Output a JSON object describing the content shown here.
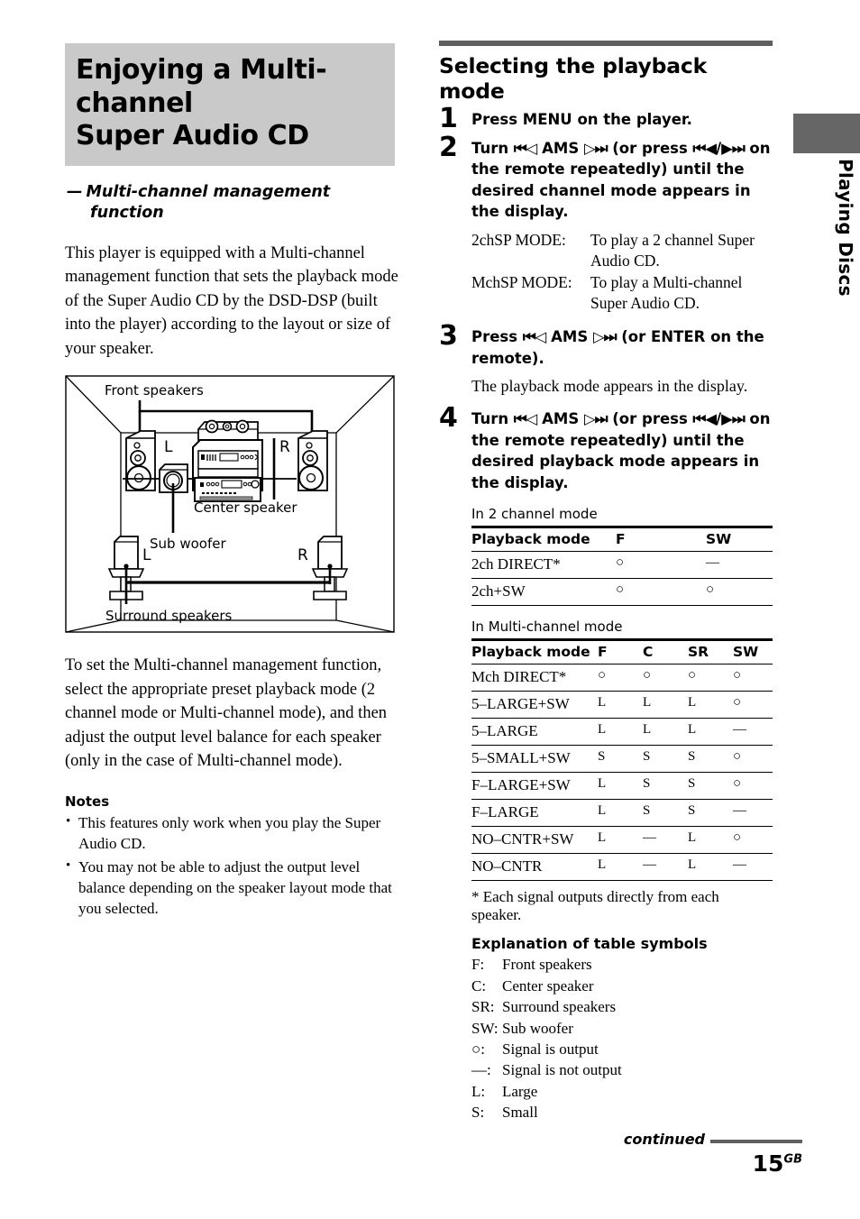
{
  "chapter": {
    "title_line1": "Enjoying a Multi-channel",
    "title_line2": "Super Audio CD",
    "subtitle_dash": "—",
    "subtitle_line1": "Multi-channel management",
    "subtitle_line2": "function"
  },
  "left": {
    "intro_paragraph": "This player is equipped with a Multi-channel management function that sets the playback mode of the Super Audio CD by the DSD-DSP (built into the player) according to the layout or size of your speaker.",
    "diagram": {
      "label_front": "Front speakers",
      "label_center": "Center speaker",
      "label_sub": "Sub woofer",
      "label_surround": "Surround speakers",
      "label_front_left": "L",
      "label_front_right": "R",
      "label_surround_left": "L",
      "label_surround_right": "R"
    },
    "second_paragraph": "To set the Multi-channel management function, select the appropriate preset playback mode (2 channel mode or Multi-channel mode), and then adjust the output level balance for each speaker (only in the case of Multi-channel mode).",
    "notes_heading": "Notes",
    "notes": [
      "This features only work when you play the Super Audio CD.",
      "You may not be able to adjust the output level balance depending on the speaker layout mode that you selected."
    ]
  },
  "right": {
    "section_heading": "Selecting the playback mode",
    "steps": [
      {
        "num": "1",
        "text_parts": [
          "Press MENU on the player."
        ]
      },
      {
        "num": "2",
        "prefix": "Turn",
        "sym_left": "⏮◁",
        "ams": "AMS",
        "sym_right": "▷⏭",
        "mid": "(or press",
        "sym_rew": "⏮◀",
        "slash": "/",
        "sym_ff": "▶⏭",
        "suffix": "on the remote repeatedly) until the desired channel mode appears in the display."
      },
      {
        "num": "3",
        "prefix": "Press",
        "sym_left": "⏮◁",
        "ams": "AMS",
        "sym_right": "▷⏭",
        "suffix": "(or ENTER on the remote).",
        "sub": "The playback mode appears in the display."
      },
      {
        "num": "4",
        "prefix": "Turn",
        "sym_left": "⏮◁",
        "ams": "AMS",
        "sym_right": "▷⏭",
        "mid": "(or press",
        "sym_rew": "⏮◀",
        "slash": "/",
        "sym_ff": "▶⏭",
        "suffix": "on the remote repeatedly) until the desired playback mode appears in the display."
      }
    ],
    "modes": [
      {
        "key": "2chSP MODE:",
        "val_line1": "To play a 2 channel Super",
        "val_line2": "Audio CD."
      },
      {
        "key": "MchSP MODE:",
        "val_line1": "To play a Multi-channel",
        "val_line2": "Super Audio CD."
      }
    ],
    "table_2ch": {
      "caption": "In 2 channel mode",
      "headers": [
        "Playback mode",
        "F",
        "SW"
      ],
      "rows": [
        [
          "2ch DIRECT*",
          "○",
          "—"
        ],
        [
          "2ch+SW",
          "○",
          "○"
        ]
      ]
    },
    "table_mch": {
      "caption": "In Multi-channel mode",
      "headers": [
        "Playback mode",
        "F",
        "C",
        "SR",
        "SW"
      ],
      "rows": [
        [
          "Mch DIRECT*",
          "○",
          "○",
          "○",
          "○"
        ],
        [
          "5–LARGE+SW",
          "L",
          "L",
          "L",
          "○"
        ],
        [
          "5–LARGE",
          "L",
          "L",
          "L",
          "—"
        ],
        [
          "5–SMALL+SW",
          "S",
          "S",
          "S",
          "○"
        ],
        [
          "F–LARGE+SW",
          "L",
          "S",
          "S",
          "○"
        ],
        [
          "F–LARGE",
          "L",
          "S",
          "S",
          "—"
        ],
        [
          "NO–CNTR+SW",
          "L",
          "—",
          "L",
          "○"
        ],
        [
          "NO–CNTR",
          "L",
          "—",
          "L",
          "—"
        ]
      ]
    },
    "footnote": "* Each signal outputs directly from each speaker.",
    "explanation_heading": "Explanation of table symbols",
    "explanation": [
      {
        "key": "F:",
        "val": "Front speakers"
      },
      {
        "key": "C:",
        "val": "Center speaker"
      },
      {
        "key": "SR:",
        "val": "Surround speakers"
      },
      {
        "key": "SW:",
        "val": "Sub woofer"
      },
      {
        "key": "○:",
        "val": "Signal is output"
      },
      {
        "key": "—:",
        "val": "Signal is not output"
      },
      {
        "key": "L:",
        "val": "Large"
      },
      {
        "key": "S:",
        "val": "Small"
      }
    ]
  },
  "side_tab": {
    "label": "Playing Discs"
  },
  "footer": {
    "continued": "continued",
    "page_number": "15",
    "page_suffix": "GB"
  },
  "colors": {
    "title_background": "#c9c9c9",
    "rule": "#5f5f5f",
    "side_tab": "#666666"
  }
}
